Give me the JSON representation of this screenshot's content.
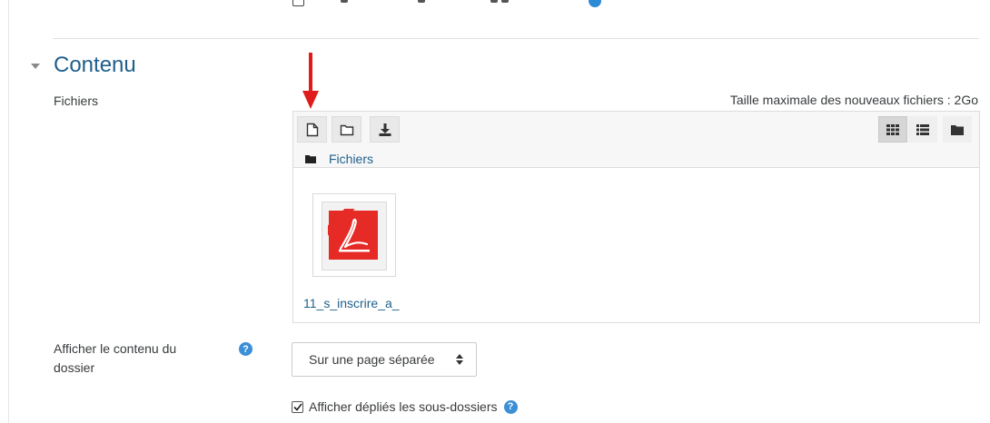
{
  "section": {
    "title": "Contenu"
  },
  "files_field": {
    "label": "Fichiers",
    "max_size": "Taille maximale des nouveaux fichiers : 2Go",
    "toolbar": {
      "add_icon": "file-add-icon",
      "folder_icon": "create-folder-icon",
      "download_icon": "download-icon",
      "view_icons": [
        "grid-view-icon",
        "list-view-icon",
        "tree-view-icon"
      ]
    },
    "breadcrumb": {
      "label": "Fichiers"
    },
    "files": [
      {
        "name": "11_s_inscrire_a_",
        "icon": "pdf-icon"
      }
    ]
  },
  "display_field": {
    "label": "Afficher le contenu du dossier",
    "help": "?",
    "select_value": "Sur une page séparée"
  },
  "subfolders_checkbox": {
    "label": "Afficher dépliés les sous-dossiers",
    "checked": true,
    "help": "?"
  },
  "colors": {
    "link": "#1f5f8b",
    "help": "#3a8fd6",
    "annotation_arrow": "#e01b1b"
  }
}
